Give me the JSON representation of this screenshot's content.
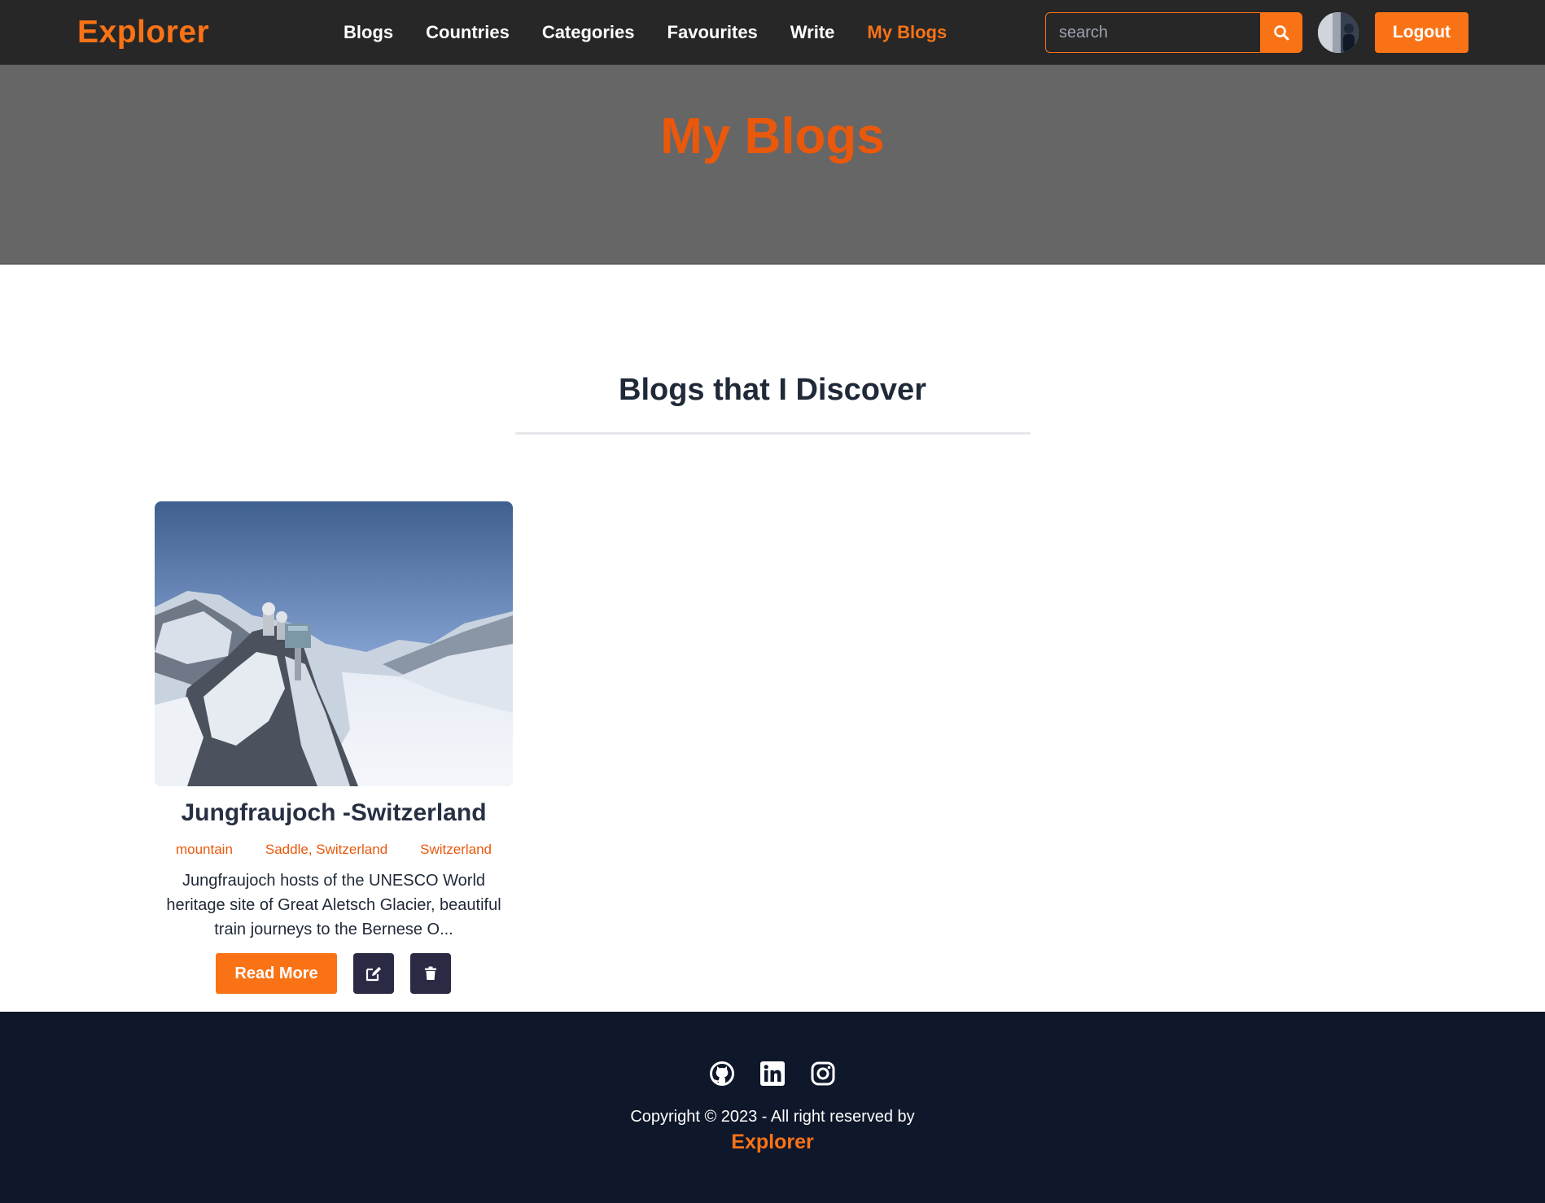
{
  "navbar": {
    "brand": "Explorer",
    "links": [
      {
        "label": "Blogs"
      },
      {
        "label": "Countries"
      },
      {
        "label": "Categories"
      },
      {
        "label": "Favourites"
      },
      {
        "label": "Write"
      },
      {
        "label": "My Blogs",
        "active": true
      }
    ],
    "search_placeholder": "search",
    "search_icon": "search-icon",
    "logout_label": "Logout"
  },
  "hero": {
    "title": "My Blogs"
  },
  "section": {
    "title": "Blogs that I Discover"
  },
  "blogs": [
    {
      "title": "Jungfraujoch -Switzerland",
      "tags": [
        "mountain",
        "Saddle, Switzerland",
        "Switzerland"
      ],
      "excerpt": "Jungfraujoch hosts of the UNESCO World heritage site of Great Aletsch Glacier, beautiful train journeys to the Bernese O...",
      "read_more_label": "Read More",
      "edit_icon": "edit-icon",
      "delete_icon": "trash-icon"
    }
  ],
  "footer": {
    "social_icons": [
      "github-icon",
      "linkedin-icon",
      "instagram-icon"
    ],
    "copyright": "Copyright © 2023 - All right reserved by",
    "brand": "Explorer"
  },
  "colors": {
    "accent": "#f97316",
    "accent_dark": "#ea580c",
    "navbar_bg": "#272727",
    "hero_bg": "#666666",
    "footer_bg": "#0f172a",
    "icon_button_bg": "#2b2a45"
  }
}
